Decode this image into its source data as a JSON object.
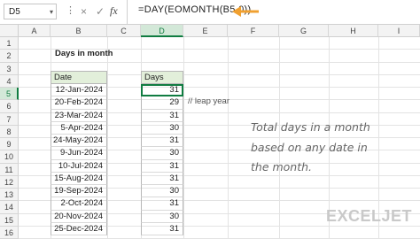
{
  "formula_bar": {
    "name_box": "D5",
    "formula": "=DAY(EOMONTH(B5,0))",
    "fx": "fx",
    "cancel_icon": "×",
    "confirm_icon": "✓",
    "more_icon": "⋮"
  },
  "columns": [
    "A",
    "B",
    "C",
    "D",
    "E",
    "F",
    "G",
    "H",
    "I"
  ],
  "rows": [
    "1",
    "2",
    "3",
    "4",
    "5",
    "6",
    "7",
    "8",
    "9",
    "10",
    "11",
    "12",
    "13",
    "14",
    "15",
    "16"
  ],
  "sheet": {
    "title": "Days in month",
    "date_header": "Date",
    "days_header": "Days",
    "dates": [
      "12-Jan-2024",
      "20-Feb-2024",
      "23-Mar-2024",
      "5-Apr-2024",
      "24-May-2024",
      "9-Jun-2024",
      "10-Jul-2024",
      "15-Aug-2024",
      "19-Sep-2024",
      "2-Oct-2024",
      "20-Nov-2024",
      "25-Dec-2024"
    ],
    "days": [
      "31",
      "29",
      "31",
      "30",
      "31",
      "30",
      "31",
      "31",
      "30",
      "31",
      "30",
      "31"
    ],
    "leap_note": "//  leap year",
    "explanation": [
      "Total days in a month",
      "based on any date in",
      "the month."
    ]
  },
  "brand": "EXCELJET",
  "colors": {
    "accent": "#107c41",
    "header_fill": "#e2efda",
    "arrow": "#f0a030"
  }
}
